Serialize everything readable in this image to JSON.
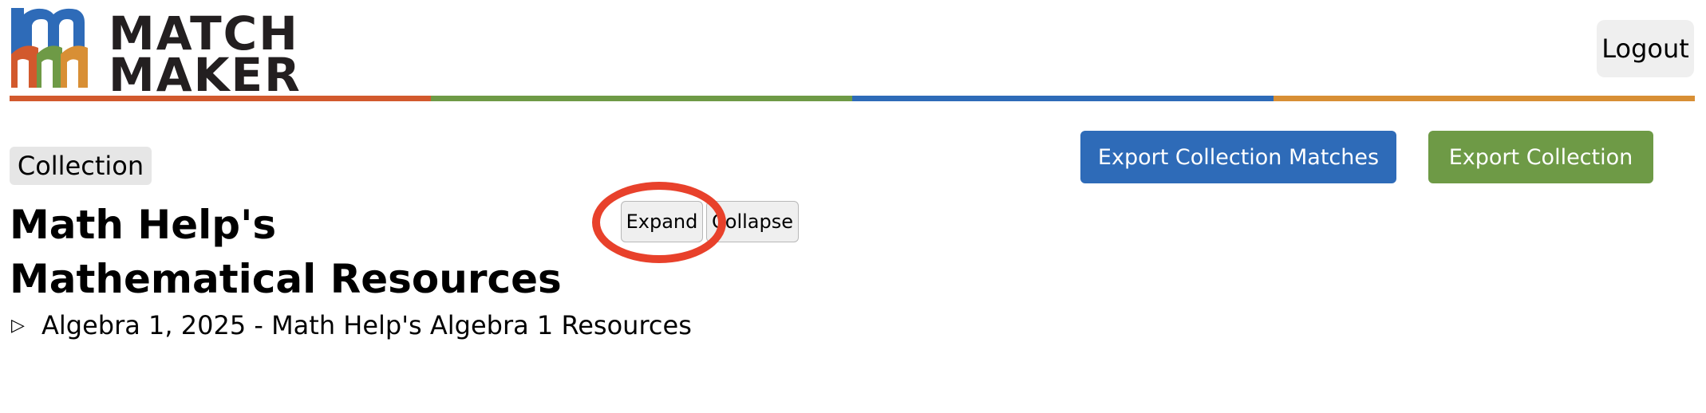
{
  "header": {
    "logo": {
      "line1": "Match",
      "line2": "Maker",
      "colors": [
        "#2e6bb8",
        "#d2592d",
        "#6e9a46",
        "#d88f35"
      ]
    },
    "logout_label": "Logout",
    "rainbow_colors": [
      "#d2592d",
      "#6e9a46",
      "#2e6bb8",
      "#d88f35"
    ]
  },
  "collection": {
    "badge": "Collection",
    "export_matches_label": "Export Collection Matches",
    "export_collection_label": "Export Collection",
    "title": "Math Help's Mathematical Resources",
    "expand_label": "Expand",
    "collapse_label": "Collapse",
    "items": [
      {
        "toggle_icon": "triangle-right-icon",
        "toggle_glyph": "▷",
        "label": "Algebra 1, 2025 - Math Help's Algebra 1 Resources"
      }
    ]
  },
  "colors": {
    "primary_blue": "#2e6bb8",
    "primary_green": "#6e9a46",
    "highlight_red": "#e8412b"
  }
}
